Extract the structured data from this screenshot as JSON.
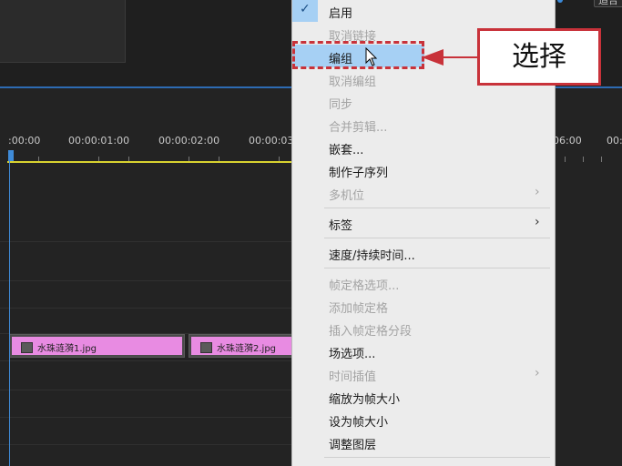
{
  "top_right_control": "适合",
  "ruler": {
    "labels": [
      ":00:00",
      "00:00:01:00",
      "00:00:02:00",
      "00:00:03",
      "06:00",
      "00:"
    ]
  },
  "clips": [
    {
      "label": "水珠涟漪1.jpg"
    },
    {
      "label": "水珠涟漪2.jpg"
    }
  ],
  "menu": {
    "items": [
      {
        "label": "启用",
        "enabled": true,
        "checked": true
      },
      {
        "label": "取消链接",
        "enabled": false
      },
      {
        "label": "编组",
        "enabled": true,
        "highlighted": true
      },
      {
        "label": "取消编组",
        "enabled": false
      },
      {
        "label": "同步",
        "enabled": false
      },
      {
        "label": "合并剪辑...",
        "enabled": false
      },
      {
        "label": "嵌套...",
        "enabled": true
      },
      {
        "label": "制作子序列",
        "enabled": true
      },
      {
        "label": "多机位",
        "enabled": false,
        "submenu": true
      },
      {
        "label": "标签",
        "enabled": true,
        "submenu": true
      },
      {
        "label": "速度/持续时间...",
        "enabled": true
      },
      {
        "label": "帧定格选项...",
        "enabled": false
      },
      {
        "label": "添加帧定格",
        "enabled": false
      },
      {
        "label": "插入帧定格分段",
        "enabled": false
      },
      {
        "label": "场选项...",
        "enabled": true
      },
      {
        "label": "时间插值",
        "enabled": false,
        "submenu": true
      },
      {
        "label": "缩放为帧大小",
        "enabled": true
      },
      {
        "label": "设为帧大小",
        "enabled": true
      },
      {
        "label": "调整图层",
        "enabled": true
      }
    ],
    "submenu_arrow": "›",
    "check_glyph": "✓"
  },
  "callout": {
    "text": "选择"
  },
  "colors": {
    "menu_bg": "#ececec",
    "highlight": "#a6d0f4",
    "annotation_red": "#c8323a",
    "clip_pink": "#e88be2",
    "playhead_blue": "#3f8bd8",
    "workarea_yellow": "#d8d230"
  }
}
